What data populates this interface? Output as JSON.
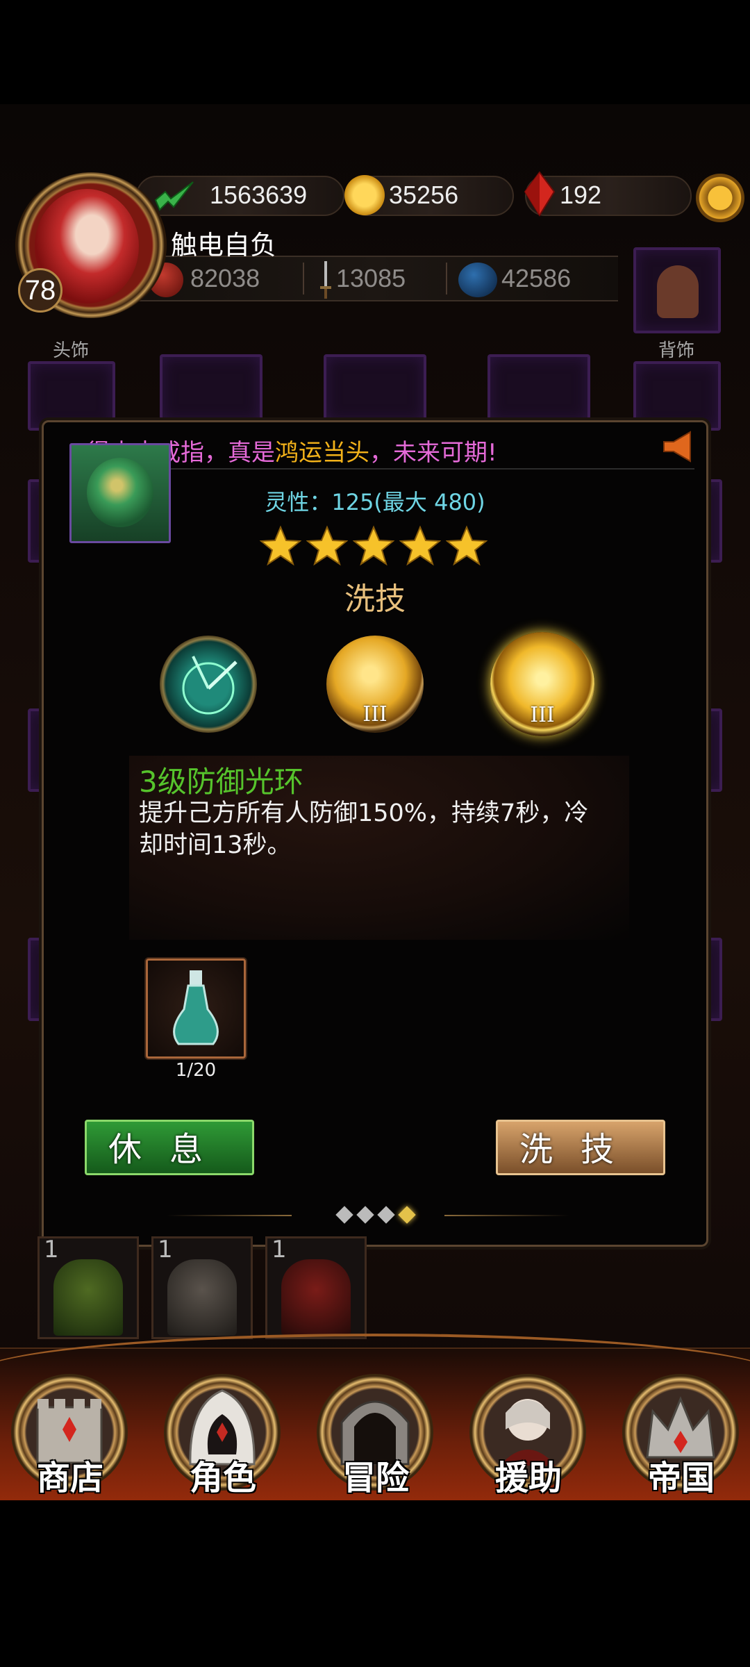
{
  "header": {
    "level": "78",
    "player_name": "触电自负",
    "resources": {
      "power": "1563639",
      "gold": "35256",
      "gems": "192"
    },
    "stats": {
      "food": "82038",
      "attack": "13085",
      "mana": "42586"
    }
  },
  "equipment_slots": {
    "head_label": "头饰",
    "back_label": "背饰"
  },
  "dialog": {
    "ticker": "得未来戒指，真是鸿运当头，未来可期!",
    "ticker_prefix": "得未来戒指，真是",
    "ticker_highlight": "鸿运当头",
    "ticker_suffix": "，未来可期!",
    "spirit_text": "灵性：125(最大 480)",
    "stars": 5,
    "section_title": "洗技",
    "skills": [
      {
        "name": "radar-skill-icon",
        "level": ""
      },
      {
        "name": "sword-slash-skill-icon",
        "level": "III"
      },
      {
        "name": "defense-aura-skill-icon",
        "level": "III"
      }
    ],
    "selected_skill": {
      "name": "3级防御光环",
      "description": "提升己方所有人防御150%，持续7秒，冷却时间13秒。"
    },
    "potion_count": "1/20",
    "rest_button": "休息",
    "wash_button": "洗技",
    "page_count": 4,
    "active_page": 4
  },
  "cards": [
    {
      "count": "1"
    },
    {
      "count": "1"
    },
    {
      "count": "1"
    }
  ],
  "nav": {
    "items": [
      {
        "label": "商店"
      },
      {
        "label": "角色"
      },
      {
        "label": "冒险"
      },
      {
        "label": "援助"
      },
      {
        "label": "帝国"
      }
    ]
  },
  "colors": {
    "skill_name": "#56c42c",
    "spirit_text": "#6fd5e4",
    "ticker_main": "#e56ad8",
    "ticker_highlight": "#f3b21a",
    "section_title": "#e8c07d"
  }
}
